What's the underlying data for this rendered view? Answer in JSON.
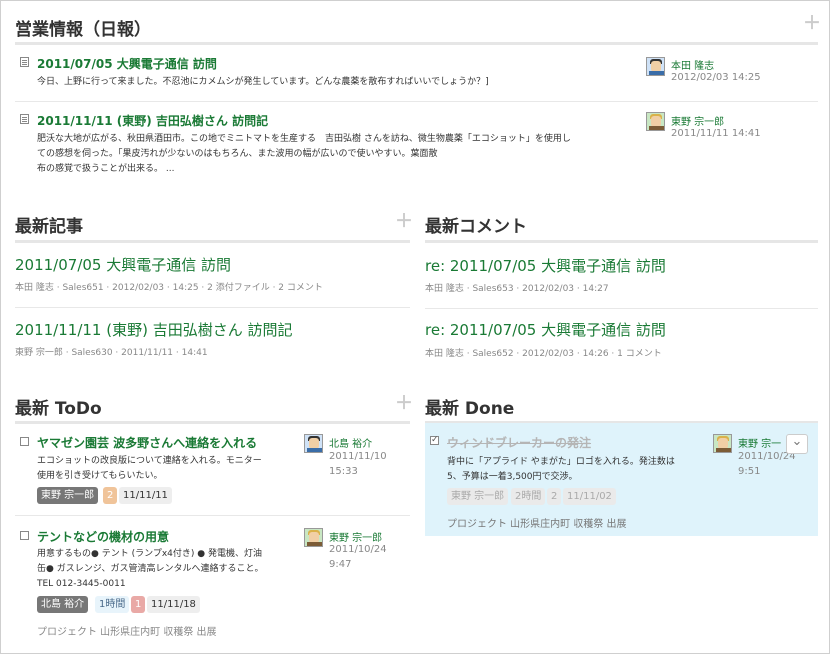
{
  "daily": {
    "title": "営業情報（日報）",
    "items": [
      {
        "title": "2011/07/05 大興電子通信 訪問",
        "body": [
          "今日、上野に行って来ました。不忍池にカメムシが発生しています。どんな農薬を散布すればいいでしょうか？]"
        ],
        "author": "本田 隆志",
        "date": "2012/02/03 14:25"
      },
      {
        "title": "2011/11/11 (東野) 吉田弘樹さん 訪問記",
        "body": [
          "肥沃な大地が広がる、秋田県酒田市。この地でミニトマトを生産する　吉田弘樹 さんを訪ね、微生物農薬「エコショット」を使用し",
          "ての感想を伺った。「果皮汚れが少ないのはもちろん、また波用の幅が広いので使いやすい。葉面散",
          " 布の感覚で扱うことが出来る。 ..."
        ],
        "author": "東野 宗一郎",
        "date": "2011/11/11 14:41"
      }
    ]
  },
  "articles": {
    "title": "最新記事",
    "items": [
      {
        "title": "2011/07/05 大興電子通信 訪問",
        "meta": "本田 隆志 · Sales651 · 2012/02/03 · 14:25 · 2 添付ファイル · 2 コメント"
      },
      {
        "title": "2011/11/11 (東野) 吉田弘樹さん 訪問記",
        "meta": "東野 宗一郎 · Sales630 · 2011/11/11 · 14:41"
      }
    ]
  },
  "comments": {
    "title": "最新コメント",
    "items": [
      {
        "title": "re: 2011/07/05 大興電子通信 訪問",
        "meta": "本田 隆志 · Sales653 · 2012/02/03 · 14:27"
      },
      {
        "title": "re: 2011/07/05 大興電子通信 訪問",
        "meta": "本田 隆志 · Sales652 · 2012/02/03 · 14:26 · 1 コメント"
      }
    ]
  },
  "todo": {
    "title": "最新 ToDo",
    "items": [
      {
        "title": "ヤマゼン園芸 波多野さんへ連絡を入れる",
        "body": [
          "エコショットの改良版について連絡を入れる。モニター",
          "使用を引き受けてもらいたい。"
        ],
        "assignee_tag": "東野 宗一郎",
        "count_tag": "2",
        "date_tag": "11/11/11",
        "author": "北島 裕介",
        "date": "2011/11/10",
        "time": "15:33"
      },
      {
        "title": "テントなどの機材の用意",
        "body": [
          "用意するもの● テント (ランプx4付き) ● 発電機、灯油",
          "缶● ガスレンジ、ガス管清高レンタルへ連絡すること。",
          "TEL 012-3445-0011"
        ],
        "assignee_tag": "北島 裕介",
        "hours_tag": "1時間",
        "count_tag": "1",
        "date_tag": "11/11/18",
        "project": "プロジェクト 山形県庄内町 収穫祭 出展",
        "author": "東野 宗一郎",
        "date": "2011/10/24",
        "time": "9:47"
      }
    ]
  },
  "done": {
    "title": "最新 Done",
    "item": {
      "title": "ウィンドブレーカーの発注",
      "body": [
        "背中に「アプライド やまがた」ロゴを入れる。発注数は",
        "5、予算は一着3,500円で交渉。"
      ],
      "assignee_tag": "東野 宗一郎",
      "hours_tag": "2時間",
      "count_tag": "2",
      "date_tag": "11/11/02",
      "project": "プロジェクト 山形県庄内町 収穫祭 出展",
      "author": "東野 宗一",
      "date": "2011/10/24",
      "time": "9:51"
    }
  },
  "icons": {
    "plus": "＋",
    "chevron": "⌄"
  }
}
